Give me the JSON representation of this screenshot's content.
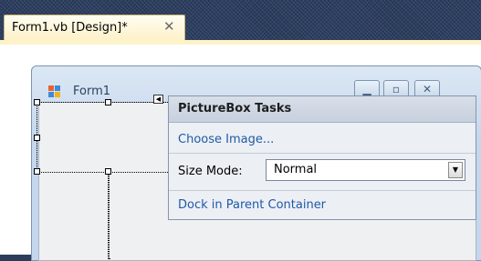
{
  "document_tab": {
    "title": "Form1.vb [Design]*",
    "close_glyph": "✕"
  },
  "form": {
    "title": "Form1",
    "icon": "form-icon",
    "caption_buttons": [
      "minimize-icon",
      "maximize-icon",
      "close-icon"
    ]
  },
  "smart_tag": {
    "icon": "smart-tag-arrow-icon"
  },
  "tasks_panel": {
    "header": "PictureBox Tasks",
    "choose_image": "Choose Image...",
    "size_mode_label": "Size Mode:",
    "size_mode_value": "Normal",
    "dock": "Dock in Parent Container"
  },
  "colors": {
    "background": "#2e3f5f",
    "tab_active": "#fdf3c9",
    "link": "#1f5aa6",
    "tasks_bg": "#eceff4"
  }
}
